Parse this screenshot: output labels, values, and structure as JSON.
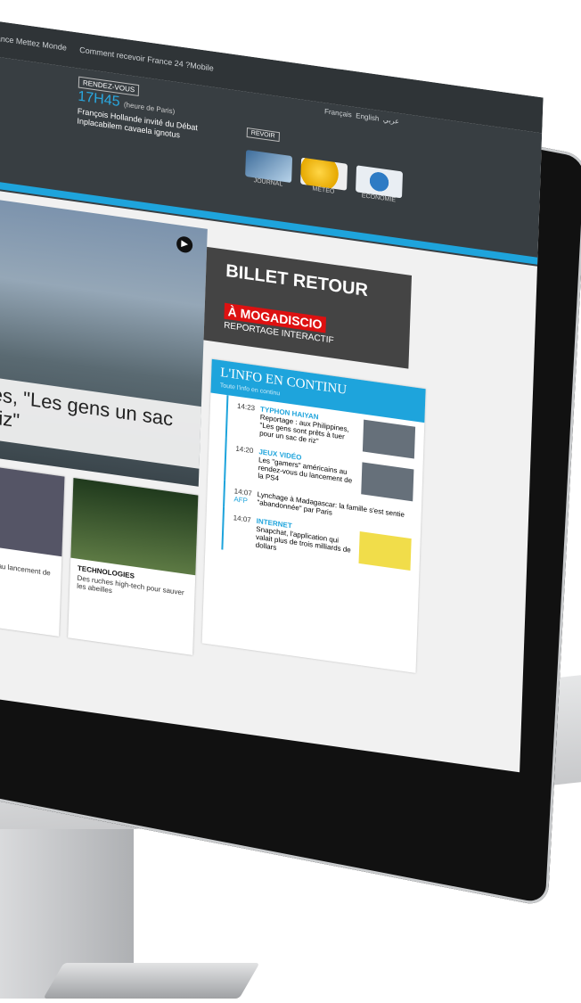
{
  "topbar": {
    "item1": "France Mettez Monde",
    "item2": "Comment recevoir France 24 ?",
    "item3": "Mobile"
  },
  "header": {
    "rdv_tag": "RENDEZ-VOUS",
    "rdv_time": "17H45",
    "rdv_time_sub": "(heure de Paris)",
    "rdv_text": "François Hollande invité du Débat Inplacabilem cavaela ignotus",
    "languages": [
      "Français",
      "English",
      "عربي"
    ],
    "replay_tag": "REVOIR",
    "replay_tiles": [
      {
        "label": "JOURNAL",
        "icon": "journal-icon"
      },
      {
        "label": "MÉTÉO",
        "icon": "weather-icon"
      },
      {
        "label": "ÉCONOMIE",
        "icon": "economy-icon"
      }
    ]
  },
  "hero": {
    "caption": "pines, \"Les gens un sac de riz\""
  },
  "ad": {
    "line1": "BILLET RETOUR",
    "line2": "À MOGADISCIO",
    "line3": "REPORTAGE INTERACTIF"
  },
  "continu": {
    "title": "L'INFO EN CONTINU",
    "subtitle": "Toute l'info en continu",
    "items": [
      {
        "time": "14:23",
        "category": "TYPHON HAIYAN",
        "text": "Reportage : aux Philippines, \"Les gens sont prêts à tuer pour un sac de riz\""
      },
      {
        "time": "14:20",
        "category": "JEUX VIDÉO",
        "text": "Les \"gamers\" américains au rendez-vous du lancement de la PS4"
      },
      {
        "time": "14:07",
        "source": "AFP",
        "category": "",
        "text": "Lynchage à Madagascar: la famille s'est sentie \"abandonnée\" par Paris"
      },
      {
        "time": "14:07",
        "category": "INTERNET",
        "text": "Snapchat, l'application qui valait plus de trois milliards de dollars"
      }
    ]
  },
  "cards": [
    {
      "category": "",
      "text": "américains au lancement de"
    },
    {
      "category": "TECHNOLOGIES",
      "text": "Des ruches high-tech pour sauver les abeilles"
    }
  ]
}
